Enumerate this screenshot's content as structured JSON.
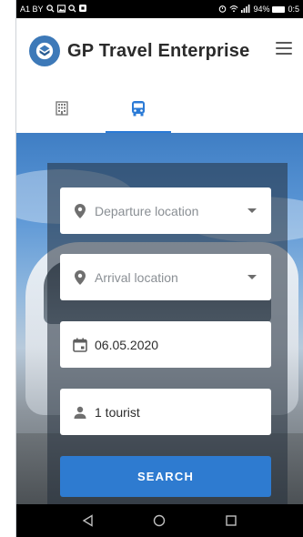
{
  "status_bar": {
    "left_text": "A1 BY",
    "left_icons": [
      "search-icon",
      "image-icon",
      "search-icon",
      "app-icon"
    ],
    "battery_percent": "94%",
    "time": "0:5"
  },
  "header": {
    "brand": "GP Travel Enterprise",
    "logo_color": "#3d79b8"
  },
  "tabs": [
    {
      "name": "hotel",
      "icon": "building-icon",
      "active": false
    },
    {
      "name": "bus",
      "icon": "bus-icon",
      "active": true
    }
  ],
  "search_form": {
    "departure_placeholder": "Departure location",
    "arrival_placeholder": "Arrival location",
    "date_value": "06.05.2020",
    "tourists_value": "1 tourist",
    "search_label": "SEARCH"
  },
  "colors": {
    "accent": "#2e7bd0",
    "tab_active": "#2a7ad6"
  }
}
